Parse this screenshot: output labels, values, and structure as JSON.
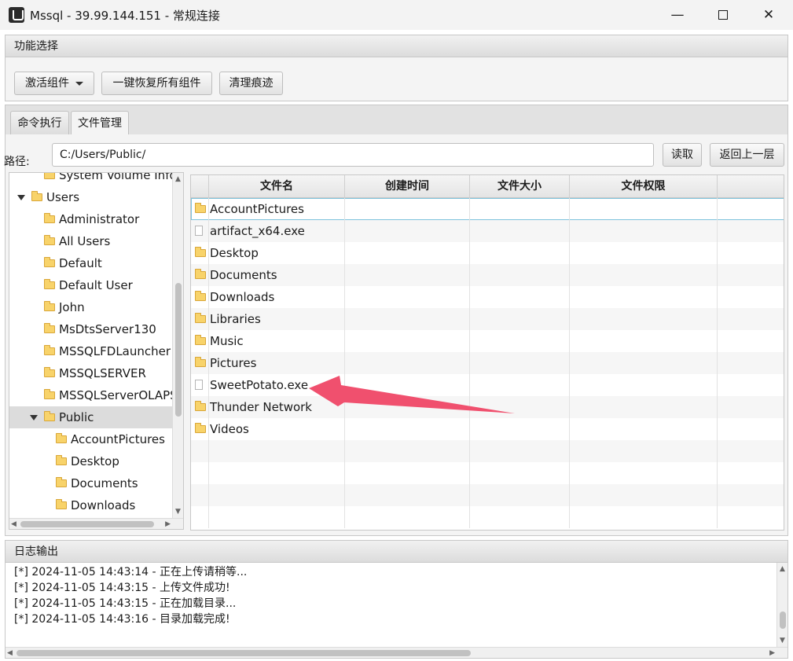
{
  "window": {
    "title": "Mssql - 39.99.144.151 - 常规连接",
    "min_glyph": "—",
    "close_glyph": "✕"
  },
  "func": {
    "header": "功能选择",
    "activate_label": "激活组件",
    "restore_label": "一键恢复所有组件",
    "clean_label": "清理痕迹"
  },
  "tabs": [
    {
      "label": "命令执行",
      "active": false
    },
    {
      "label": "文件管理",
      "active": true
    }
  ],
  "path": {
    "label": "路径:",
    "value": "C:/Users/Public/",
    "read_label": "读取",
    "up_label": "返回上一层"
  },
  "tree": [
    {
      "label": "System Volume Info",
      "level": 3,
      "expand": false,
      "selected": false
    },
    {
      "label": "Users",
      "level": 2,
      "expand": true,
      "selected": false
    },
    {
      "label": "Administrator",
      "level": 3,
      "expand": false,
      "selected": false
    },
    {
      "label": "All Users",
      "level": 3,
      "expand": false,
      "selected": false
    },
    {
      "label": "Default",
      "level": 3,
      "expand": false,
      "selected": false
    },
    {
      "label": "Default User",
      "level": 3,
      "expand": false,
      "selected": false
    },
    {
      "label": "John",
      "level": 3,
      "expand": false,
      "selected": false
    },
    {
      "label": "MsDtsServer130",
      "level": 3,
      "expand": false,
      "selected": false
    },
    {
      "label": "MSSQLFDLauncher",
      "level": 3,
      "expand": false,
      "selected": false
    },
    {
      "label": "MSSQLSERVER",
      "level": 3,
      "expand": false,
      "selected": false
    },
    {
      "label": "MSSQLServerOLAPService",
      "level": 3,
      "expand": false,
      "selected": false
    },
    {
      "label": "Public",
      "level": 3,
      "expand": true,
      "selected": true
    },
    {
      "label": "AccountPictures",
      "level": 4,
      "expand": false,
      "selected": false
    },
    {
      "label": "Desktop",
      "level": 4,
      "expand": false,
      "selected": false
    },
    {
      "label": "Documents",
      "level": 4,
      "expand": false,
      "selected": false
    },
    {
      "label": "Downloads",
      "level": 4,
      "expand": false,
      "selected": false
    }
  ],
  "table": {
    "columns": [
      "文件名",
      "创建时间",
      "文件大小",
      "文件权限"
    ],
    "rows": [
      {
        "name": "AccountPictures",
        "icon": "folder"
      },
      {
        "name": "artifact_x64.exe",
        "icon": "file"
      },
      {
        "name": "Desktop",
        "icon": "folder"
      },
      {
        "name": "Documents",
        "icon": "folder"
      },
      {
        "name": "Downloads",
        "icon": "folder"
      },
      {
        "name": "Libraries",
        "icon": "folder"
      },
      {
        "name": "Music",
        "icon": "folder"
      },
      {
        "name": "Pictures",
        "icon": "folder"
      },
      {
        "name": "SweetPotato.exe",
        "icon": "file"
      },
      {
        "name": "Thunder Network",
        "icon": "folder"
      },
      {
        "name": "Videos",
        "icon": "folder"
      }
    ]
  },
  "log": {
    "header": "日志输出",
    "lines": [
      "[*] 2024-11-05 14:43:14 - 正在上传请稍等...",
      "[*] 2024-11-05 14:43:15 - 上传文件成功!",
      "[*] 2024-11-05 14:43:15 - 正在加载目录...",
      "[*] 2024-11-05 14:43:16 - 目录加载完成!"
    ]
  },
  "colors": {
    "annotation_arrow": "#f0506e",
    "folder": "#f8d36a",
    "selection": "#dcdcdc"
  }
}
